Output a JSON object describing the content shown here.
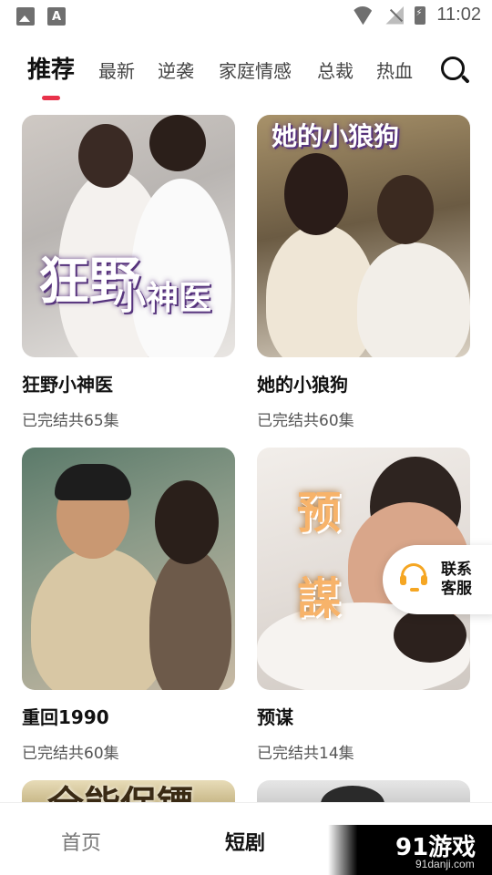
{
  "status_bar": {
    "time": "11:02",
    "font_icon_glyph": "A"
  },
  "tabs": [
    {
      "label": "推荐",
      "active": true
    },
    {
      "label": "最新",
      "active": false
    },
    {
      "label": "逆袭",
      "active": false
    },
    {
      "label": "家庭情感",
      "active": false
    },
    {
      "label": "总裁",
      "active": false
    },
    {
      "label": "热血",
      "active": false
    }
  ],
  "accent_color": "#e8324a",
  "dramas": [
    {
      "title": "狂野小神医",
      "meta": "已完结共65集",
      "poster_text_1": "狂野",
      "poster_text_2": "小神医"
    },
    {
      "title": "她的小狼狗",
      "meta": "已完结共60集",
      "poster_text_1": "她的小狼狗"
    },
    {
      "title": "重回1990",
      "meta": "已完结共60集"
    },
    {
      "title": "预谋",
      "meta": "已完结共14集",
      "poster_text_1": "预",
      "poster_text_2": "謀"
    },
    {
      "poster_text_1": "全能保镖"
    },
    {}
  ],
  "customer_service": {
    "label": "联系客服",
    "icon": "headset-icon"
  },
  "bottom_nav": [
    {
      "label": "首页",
      "active": false
    },
    {
      "label": "短剧",
      "active": true
    }
  ],
  "watermark": {
    "logo": "91游戏",
    "url": "91danji.com"
  }
}
